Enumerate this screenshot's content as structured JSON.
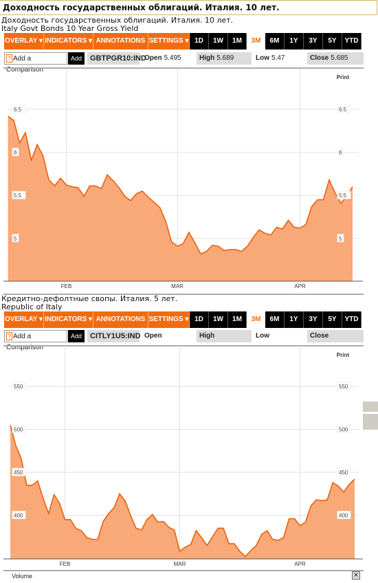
{
  "page_title": "Доходность государственных облигаций. Италия. 10 лет.",
  "toolbar": {
    "menus": [
      "OVERLAY ▾",
      "INDICATORS ▾",
      "ANNOTATIONS ▾",
      "SETTINGS ▾"
    ],
    "ranges": [
      "1D",
      "1W",
      "1M",
      "3M",
      "6M",
      "1Y",
      "3Y",
      "5Y",
      "YTD"
    ],
    "selected_range": "3M",
    "comparison_help": "?",
    "comparison_placeholder": "Add a Comparison",
    "add_label": "Add",
    "print_label": "Print"
  },
  "colors": {
    "accent": "#f26b0f",
    "area_fill": "#f9a878",
    "line": "#e8620c"
  },
  "chart_data": [
    {
      "type": "area",
      "title": "Доходность государственных облигаций. Италия. 10 лет.",
      "subtitle": "Italy Govt Bonds 10 Year Gross Yield",
      "ticker": "GBTPGR10:IND",
      "quote": {
        "open_label": "Open",
        "open": "5.495",
        "high_label": "High",
        "high": "5.689",
        "low_label": "Low",
        "low": "5.47",
        "close_label": "Close",
        "close": "5.685"
      },
      "y_ticks": [
        "6.5",
        "6",
        "5.5",
        "5"
      ],
      "ylim": [
        4.5,
        6.5
      ],
      "x_ticks": [
        {
          "label": "FEB",
          "at_point": 10
        },
        {
          "label": "MAR",
          "at_point": 29
        },
        {
          "label": "APR",
          "at_point": 50
        }
      ],
      "grid": true,
      "values": [
        6.42,
        6.37,
        6.11,
        6.23,
        5.91,
        6.09,
        5.96,
        5.68,
        5.61,
        5.7,
        5.62,
        5.6,
        5.59,
        5.49,
        5.61,
        5.61,
        5.58,
        5.74,
        5.67,
        5.59,
        5.49,
        5.44,
        5.52,
        5.55,
        5.48,
        5.42,
        5.36,
        5.2,
        4.96,
        4.91,
        4.94,
        5.07,
        4.95,
        4.82,
        4.85,
        4.92,
        4.91,
        4.86,
        4.87,
        4.87,
        4.85,
        4.91,
        5.01,
        5.1,
        5.06,
        5.04,
        5.13,
        5.11,
        5.21,
        5.13,
        5.12,
        5.16,
        5.37,
        5.45,
        5.45,
        5.68,
        5.53,
        5.41,
        5.49,
        5.6
      ]
    },
    {
      "type": "area",
      "title": "Кредитно-дефолтные свопы. Италия. 5 лет.",
      "subtitle": "Republic of Italy",
      "ticker": "CITLY1U5:IND",
      "quote": {
        "open_label": "Open",
        "open": "",
        "high_label": "High",
        "high": "",
        "low_label": "Low",
        "low": "",
        "close_label": "Close",
        "close": ""
      },
      "y_ticks": [
        "550",
        "500",
        "450",
        "400"
      ],
      "ylim": [
        350,
        550
      ],
      "x_ticks": [
        {
          "label": "FEB",
          "at_point": 10
        },
        {
          "label": "MAR",
          "at_point": 31
        },
        {
          "label": "APR",
          "at_point": 53
        }
      ],
      "grid": true,
      "values": [
        505,
        481,
        466,
        435,
        435,
        440,
        420,
        402,
        424,
        414,
        395,
        395,
        385,
        382,
        374,
        372,
        372,
        393,
        402,
        409,
        425,
        417,
        400,
        385,
        383,
        395,
        401,
        392,
        393,
        386,
        383,
        358,
        363,
        366,
        382,
        374,
        365,
        375,
        385,
        385,
        367,
        367,
        358,
        352,
        359,
        365,
        378,
        382,
        372,
        371,
        374,
        396,
        396,
        388,
        392,
        411,
        418,
        417,
        418,
        438,
        434,
        427,
        436,
        442
      ],
      "footer_label": "Volume"
    }
  ]
}
